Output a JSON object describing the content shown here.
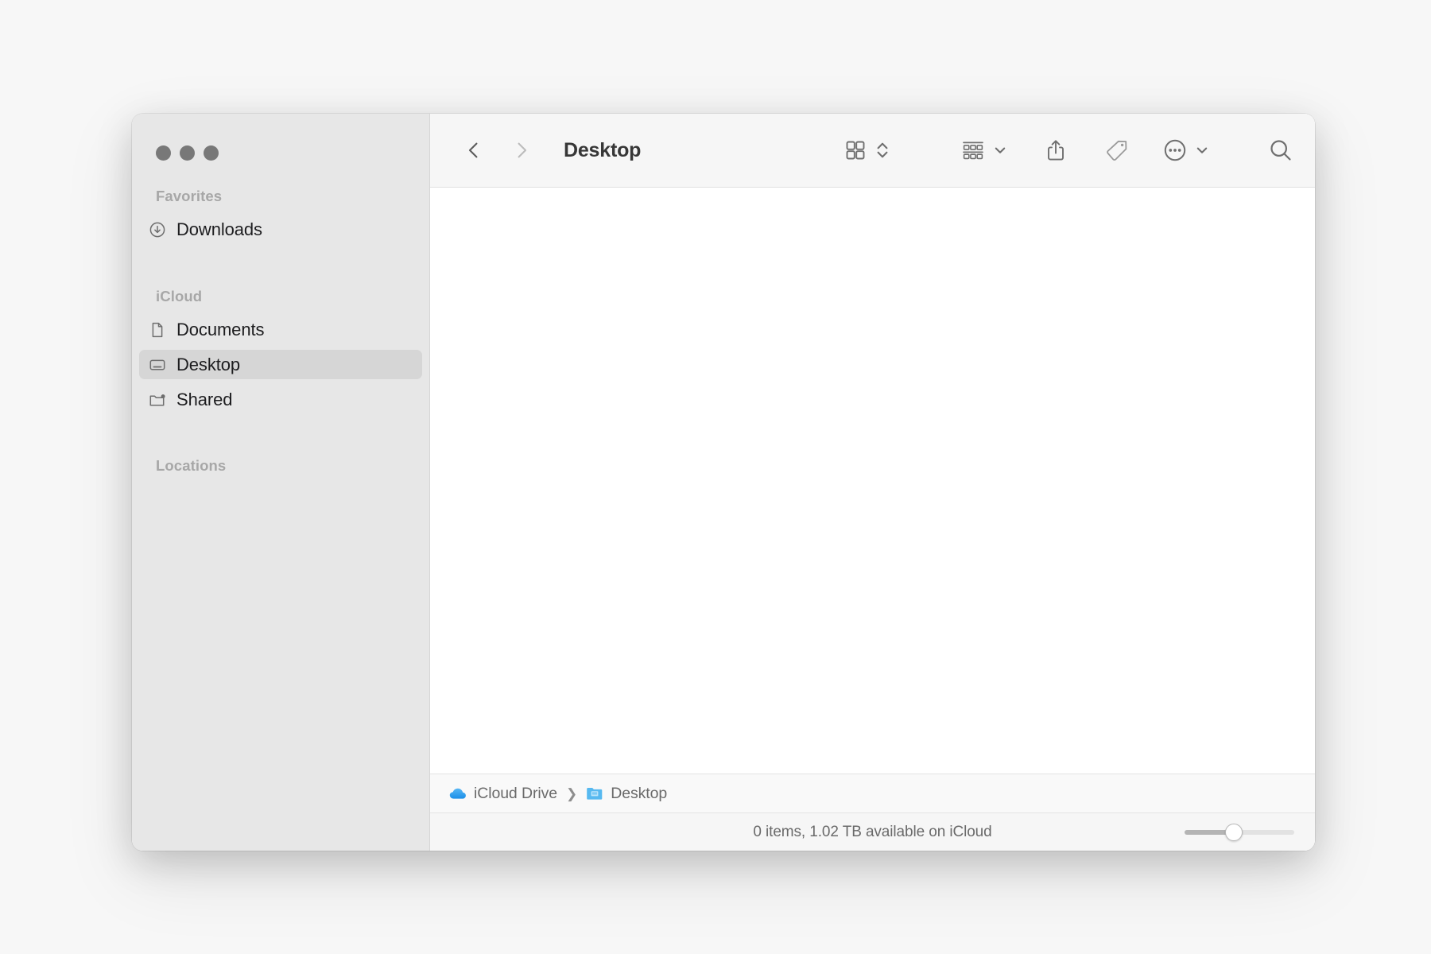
{
  "window": {
    "title": "Desktop",
    "traffic_lights": [
      {
        "name": "close",
        "color": "#787878"
      },
      {
        "name": "minimize",
        "color": "#787878"
      },
      {
        "name": "maximize",
        "color": "#787878"
      }
    ],
    "state": "inactive"
  },
  "sidebar": {
    "groups": [
      {
        "header": "Favorites",
        "items": [
          {
            "label": "Downloads",
            "icon": "download-circle-icon",
            "selected": false
          }
        ]
      },
      {
        "header": "iCloud",
        "items": [
          {
            "label": "Documents",
            "icon": "document-icon",
            "selected": false
          },
          {
            "label": "Desktop",
            "icon": "desktop-icon",
            "selected": true
          },
          {
            "label": "Shared",
            "icon": "shared-folder-icon",
            "selected": false
          }
        ]
      },
      {
        "header": "Locations",
        "items": []
      }
    ]
  },
  "toolbar": {
    "back_label": "Back",
    "forward_label": "Forward",
    "forward_disabled": true,
    "title": "Desktop",
    "buttons": [
      {
        "name": "icon-view-button",
        "icon": "grid-icon",
        "label": "Icon view"
      },
      {
        "name": "view-stepper",
        "icon": "chevron-up-down-icon",
        "label": "Change view"
      },
      {
        "name": "arrange-button",
        "icon": "group-rows-icon",
        "label": "Group items"
      },
      {
        "name": "arrange-chevron",
        "icon": "chevron-down-icon",
        "label": "Arrange options"
      },
      {
        "name": "share-button",
        "icon": "share-icon",
        "label": "Share"
      },
      {
        "name": "tag-button",
        "icon": "tag-icon",
        "label": "Edit tags"
      },
      {
        "name": "more-button",
        "icon": "ellipsis-circle-icon",
        "label": "More"
      },
      {
        "name": "more-chevron",
        "icon": "chevron-down-icon",
        "label": "More options"
      },
      {
        "name": "search-button",
        "icon": "search-icon",
        "label": "Search"
      }
    ]
  },
  "path_bar": {
    "crumbs": [
      {
        "label": "iCloud Drive",
        "icon": "cloud-icon"
      },
      {
        "label": "Desktop",
        "icon": "blue-folder-icon"
      }
    ],
    "separator": "❯"
  },
  "status_bar": {
    "text": "0 items, 1.02 TB available on iCloud",
    "item_count": 0,
    "available": "1.02 TB",
    "location": "iCloud",
    "zoom_slider": {
      "value": 45,
      "min": 0,
      "max": 100
    }
  },
  "content": {
    "items": [],
    "empty": true
  },
  "colors": {
    "sidebar_bg": "#e7e7e7",
    "toolbar_bg": "#f6f6f6",
    "content_bg": "#ffffff",
    "selection_bg": "#d6d6d6",
    "accent_blue": "#3b9ceb",
    "desktop_bg": "#f7f7f7",
    "text_primary": "#1d1d1f",
    "text_secondary": "#6a6a6a",
    "text_tertiary": "#a7a7a7"
  }
}
